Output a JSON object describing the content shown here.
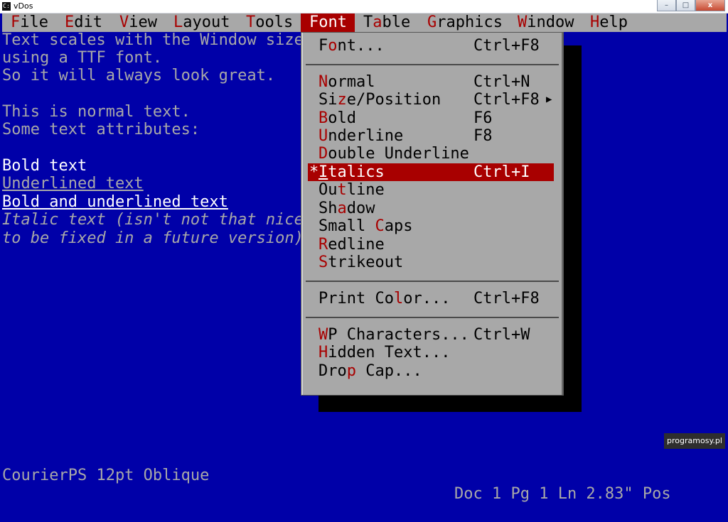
{
  "window": {
    "title": "vDos",
    "icon": "C:",
    "minimize": "–",
    "maximize": "□",
    "close": "x"
  },
  "menubar": [
    {
      "hotkey": "F",
      "rest": "ile"
    },
    {
      "hotkey": "E",
      "rest": "dit"
    },
    {
      "hotkey": "V",
      "rest": "iew"
    },
    {
      "hotkey": "L",
      "rest": "ayout"
    },
    {
      "hotkey": "T",
      "rest": "ools"
    },
    {
      "hotkey": "F",
      "rest": "ont"
    },
    {
      "pre": "T",
      "hotkey": "a",
      "rest": "ble"
    },
    {
      "hotkey": "G",
      "rest": "raphics"
    },
    {
      "hotkey": "W",
      "rest": "indow"
    },
    {
      "hotkey": "H",
      "rest": "elp"
    }
  ],
  "document": {
    "line1": "Text scales with the Window size,",
    "line2": "using a TTF font.",
    "line3": "So it will always look great.",
    "line5": "This is normal text.",
    "line6": "Some text attributes:",
    "bold": "Bold text",
    "underlined": "Underlined text",
    "bold_underlined": "Bold and underlined text",
    "italic1": "Italic text (isn't not that nice,",
    "italic2": "to be fixed in a future version)"
  },
  "font_menu": {
    "font": {
      "pre": "F",
      "hotkey": "o",
      "rest": "nt...",
      "shortcut": "Ctrl+F8"
    },
    "normal": {
      "pre": "",
      "hotkey": "N",
      "rest": "ormal",
      "shortcut": "Ctrl+N"
    },
    "size": {
      "pre": "Si",
      "hotkey": "z",
      "rest": "e/Position",
      "shortcut": "Ctrl+F8",
      "arrow": "▶"
    },
    "bold": {
      "pre": "",
      "hotkey": "B",
      "rest": "old",
      "shortcut": "F6"
    },
    "underline": {
      "pre": "",
      "hotkey": "U",
      "rest": "nderline",
      "shortcut": "F8"
    },
    "double": {
      "pre": "",
      "hotkey": "D",
      "rest": "ouble Underline",
      "shortcut": ""
    },
    "italics": {
      "mark": "*",
      "pre": "",
      "hotkey": "I",
      "rest": "talics",
      "shortcut": "Ctrl+I"
    },
    "outline": {
      "pre": "Ou",
      "hotkey": "t",
      "rest": "line",
      "shortcut": ""
    },
    "shadow": {
      "pre": "Sh",
      "hotkey": "a",
      "rest": "dow",
      "shortcut": ""
    },
    "smallcaps": {
      "pre": "Small ",
      "hotkey": "C",
      "rest": "aps",
      "shortcut": ""
    },
    "redline": {
      "pre": "",
      "hotkey": "R",
      "rest": "edline",
      "shortcut": ""
    },
    "strikeout": {
      "pre": "",
      "hotkey": "S",
      "rest": "trikeout",
      "shortcut": ""
    },
    "printcolor": {
      "pre": "Print Co",
      "hotkey": "l",
      "rest": "or...",
      "shortcut": "Ctrl+F8"
    },
    "wpchars": {
      "pre": "",
      "hotkey": "W",
      "rest": "P Characters...",
      "shortcut": "Ctrl+W"
    },
    "hidden": {
      "pre": "",
      "hotkey": "H",
      "rest": "idden Text...",
      "shortcut": ""
    },
    "dropcap": {
      "pre": "Dro",
      "hotkey": "p",
      "rest": " Cap...",
      "shortcut": ""
    }
  },
  "status": {
    "left": "CourierPS 12pt Oblique",
    "right": "Doc 1 Pg 1 Ln 2.83\" Pos"
  },
  "watermark": "programosy.pl",
  "colors": {
    "background": "#0000a8",
    "menu": "#a8a8a8",
    "highlight": "#a80000",
    "text": "#a8a8a8"
  }
}
